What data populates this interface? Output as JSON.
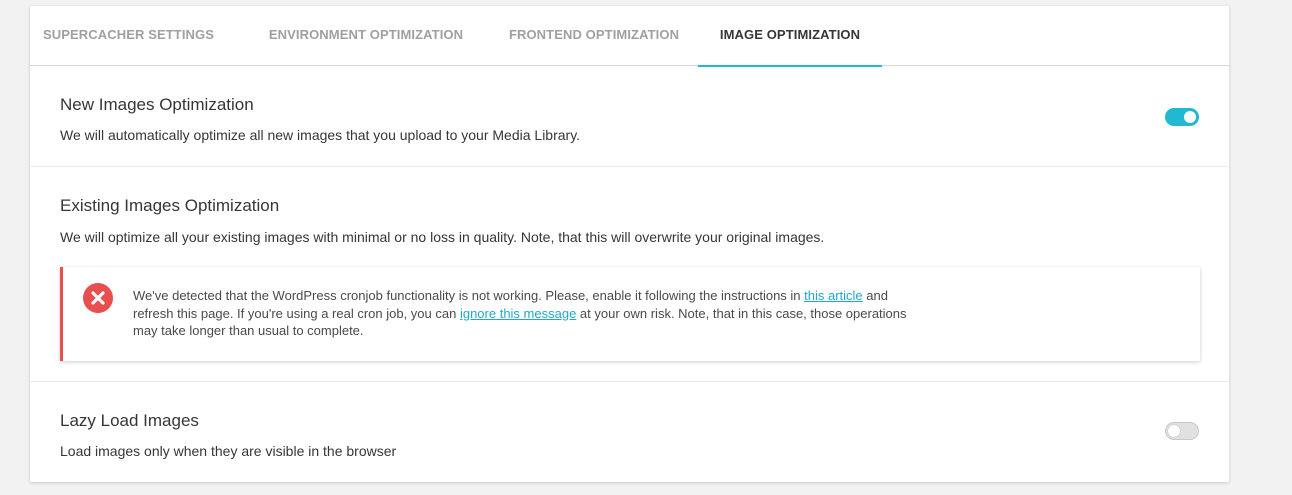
{
  "tabs": [
    {
      "label": "SUPERCACHER SETTINGS"
    },
    {
      "label": "ENVIRONMENT OPTIMIZATION"
    },
    {
      "label": "FRONTEND OPTIMIZATION"
    },
    {
      "label": "IMAGE OPTIMIZATION"
    }
  ],
  "active_tab": "IMAGE OPTIMIZATION",
  "sections": {
    "new_images": {
      "title": "New Images Optimization",
      "description": "We will automatically optimize all new images that you upload to your Media Library.",
      "toggle_state": "on"
    },
    "existing_images": {
      "title": "Existing Images Optimization",
      "description": "We will optimize all your existing images with minimal or no loss in quality. Note, that this will overwrite your original images."
    },
    "lazy_load": {
      "title": "Lazy Load Images",
      "description": "Load images only when they are visible in the browser",
      "toggle_state": "off"
    }
  },
  "alert": {
    "icon": "error-x-icon",
    "text_1": "We've detected that the WordPress cronjob functionality is not working. Please, enable it following the instructions in ",
    "link_1": "this article",
    "text_2": " and refresh this page. If you're using a real cron job, you can ",
    "link_2": "ignore this message",
    "text_3": " at your own risk. Note, that in this case, those operations may take longer than usual to complete."
  },
  "colors": {
    "accent": "#22b8d1",
    "error": "#e94f4f"
  }
}
